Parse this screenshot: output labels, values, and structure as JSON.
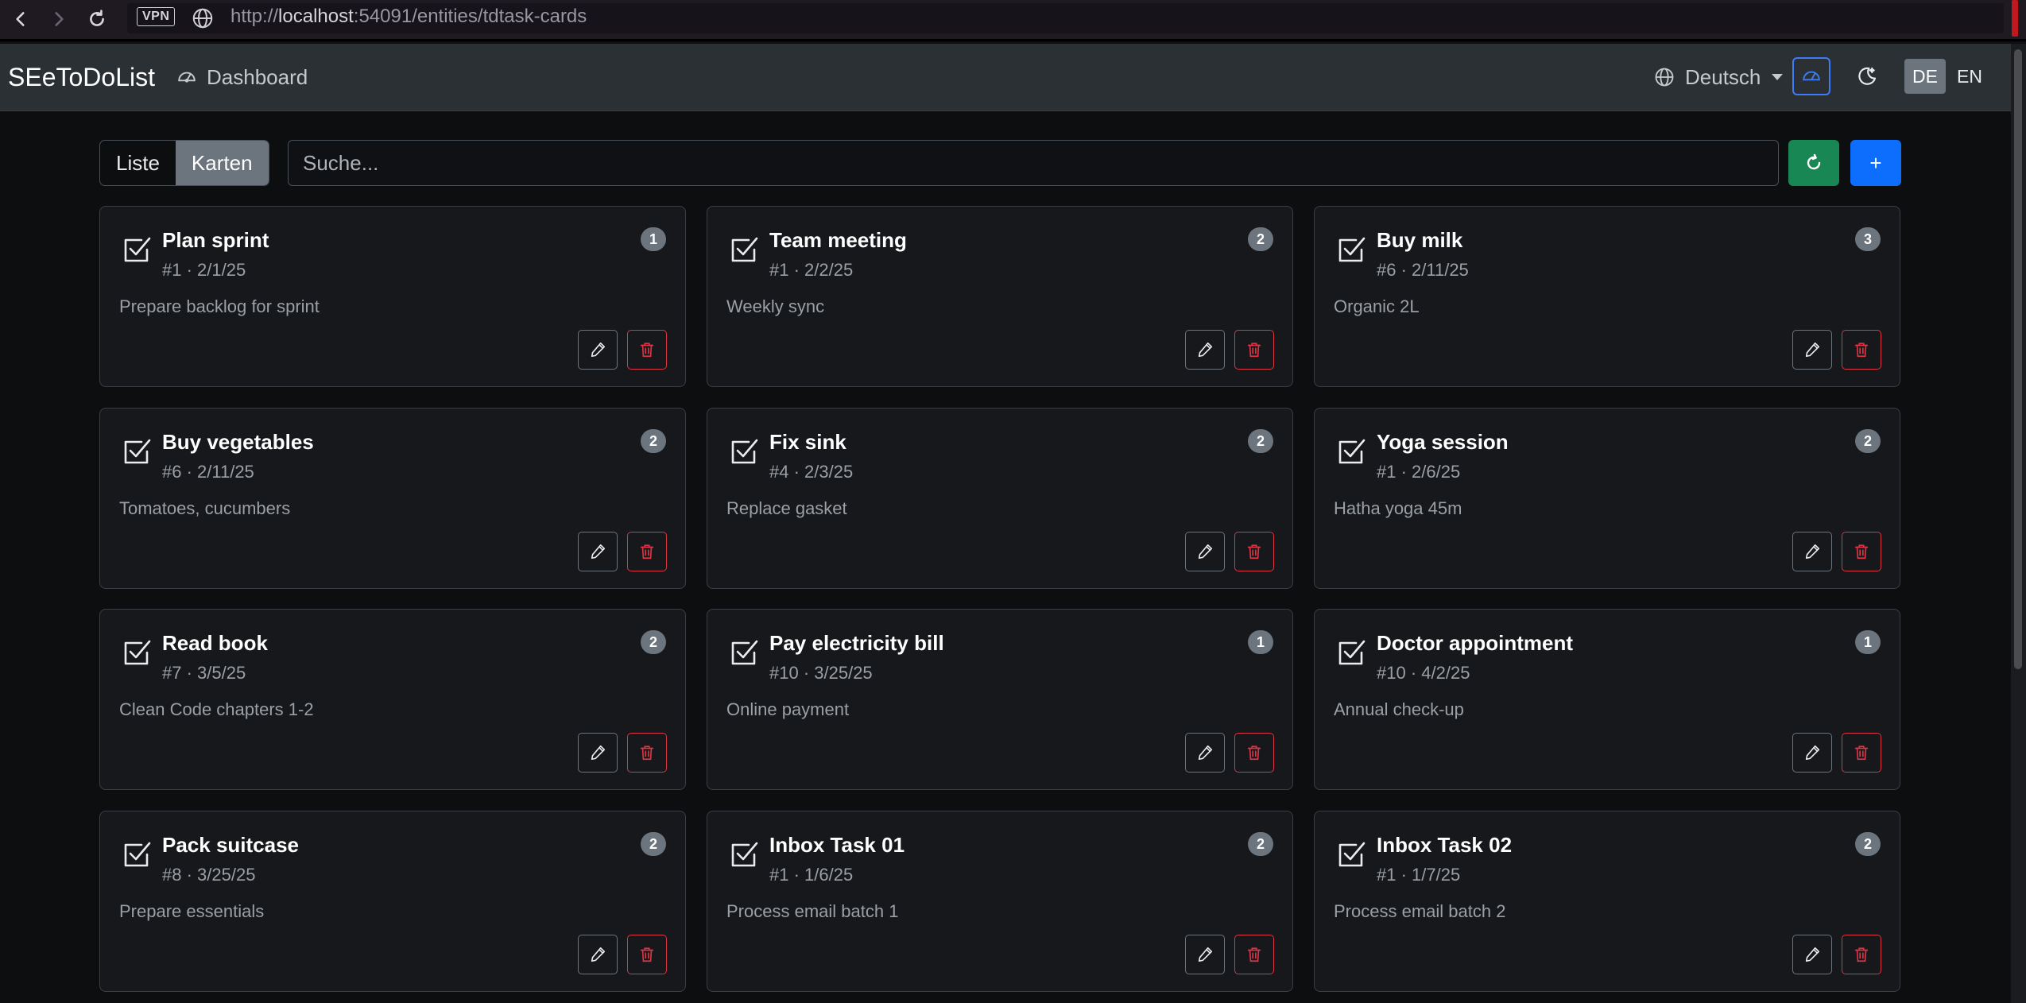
{
  "browser": {
    "url_prefix": "http://",
    "url_host": "localhost",
    "url_rest": ":54091/entities/tdtask-cards",
    "vpn_label": "VPN"
  },
  "nav": {
    "brand": "SEeToDoList",
    "dashboard_label": "Dashboard",
    "language_label": "Deutsch",
    "lang_de": "DE",
    "lang_en": "EN"
  },
  "toolbar": {
    "view_list": "Liste",
    "view_cards": "Karten",
    "search_placeholder": "Suche...",
    "add_label": "+"
  },
  "colors": {
    "accent_blue": "#0d6efd",
    "refresh_green": "#198754",
    "delete_red": "#dc3545",
    "badge_gray": "#6c757d"
  },
  "cards": [
    {
      "title": "Plan sprint",
      "meta": "#1 · 2/1/25",
      "description": "Prepare backlog for sprint",
      "badge": "1"
    },
    {
      "title": "Team meeting",
      "meta": "#1 · 2/2/25",
      "description": "Weekly sync",
      "badge": "2"
    },
    {
      "title": "Buy milk",
      "meta": "#6 · 2/11/25",
      "description": "Organic 2L",
      "badge": "3"
    },
    {
      "title": "Buy vegetables",
      "meta": "#6 · 2/11/25",
      "description": "Tomatoes, cucumbers",
      "badge": "2"
    },
    {
      "title": "Fix sink",
      "meta": "#4 · 2/3/25",
      "description": "Replace gasket",
      "badge": "2"
    },
    {
      "title": "Yoga session",
      "meta": "#1 · 2/6/25",
      "description": "Hatha yoga 45m",
      "badge": "2"
    },
    {
      "title": "Read book",
      "meta": "#7 · 3/5/25",
      "description": "Clean Code chapters 1-2",
      "badge": "2"
    },
    {
      "title": "Pay electricity bill",
      "meta": "#10 · 3/25/25",
      "description": "Online payment",
      "badge": "1"
    },
    {
      "title": "Doctor appointment",
      "meta": "#10 · 4/2/25",
      "description": "Annual check-up",
      "badge": "1"
    },
    {
      "title": "Pack suitcase",
      "meta": "#8 · 3/25/25",
      "description": "Prepare essentials",
      "badge": "2"
    },
    {
      "title": "Inbox Task 01",
      "meta": "#1 · 1/6/25",
      "description": "Process email batch 1",
      "badge": "2"
    },
    {
      "title": "Inbox Task 02",
      "meta": "#1 · 1/7/25",
      "description": "Process email batch 2",
      "badge": "2"
    }
  ]
}
